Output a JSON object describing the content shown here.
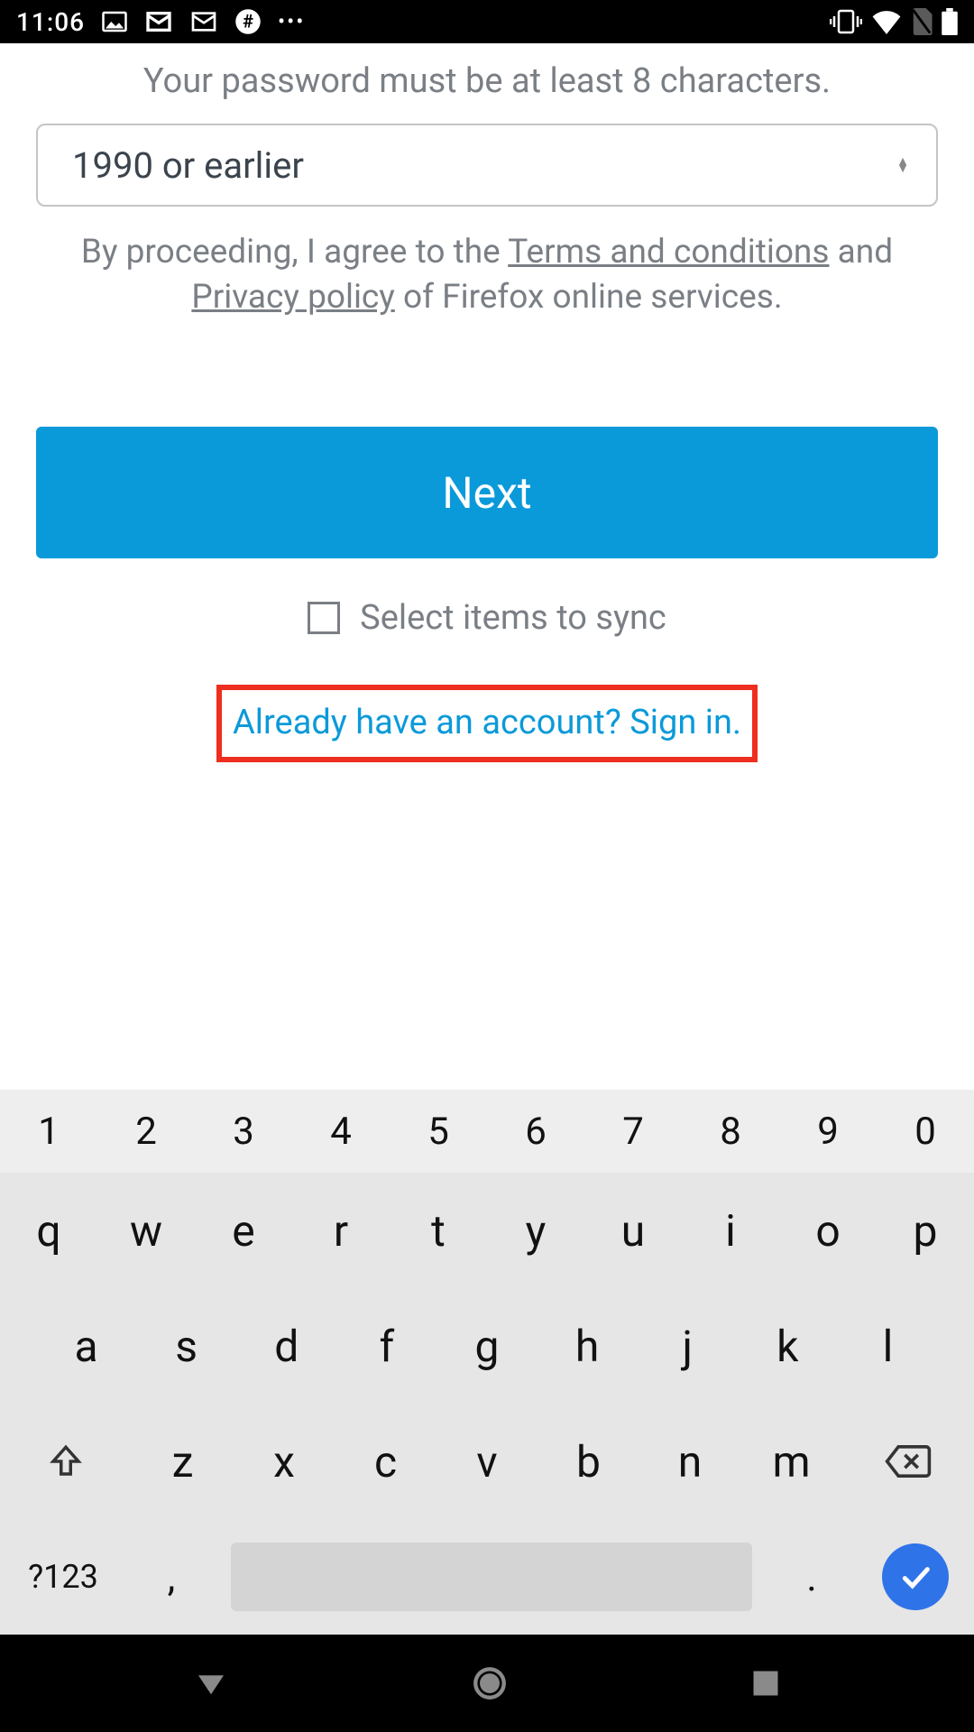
{
  "statusbar": {
    "time": "11:06",
    "icons": {
      "image": "image-icon",
      "mail1": "mail-icon",
      "mail2": "mail-icon",
      "debug": "debug-icon",
      "more": "•••",
      "vibrate": "vibrate-icon",
      "wifi": "wifi-icon",
      "sim": "sim-icon",
      "battery": "battery-icon"
    }
  },
  "form": {
    "password_hint": "Your password must be at least 8 characters.",
    "year_selected": "1990 or earlier",
    "terms_prefix": "By proceeding, I agree to the ",
    "terms_link": "Terms and conditions",
    "terms_and": " and ",
    "privacy_link": "Privacy policy",
    "terms_suffix": " of Firefox online services.",
    "next_label": "Next",
    "sync_label": "Select items to sync",
    "signin_link": "Already have an account? Sign in."
  },
  "keyboard": {
    "row_num": [
      "1",
      "2",
      "3",
      "4",
      "5",
      "6",
      "7",
      "8",
      "9",
      "0"
    ],
    "row1": [
      "q",
      "w",
      "e",
      "r",
      "t",
      "y",
      "u",
      "i",
      "o",
      "p"
    ],
    "row2": [
      "a",
      "s",
      "d",
      "f",
      "g",
      "h",
      "j",
      "k",
      "l"
    ],
    "row3": [
      "z",
      "x",
      "c",
      "v",
      "b",
      "n",
      "m"
    ],
    "sym": "?123",
    "comma": ",",
    "period": "."
  }
}
